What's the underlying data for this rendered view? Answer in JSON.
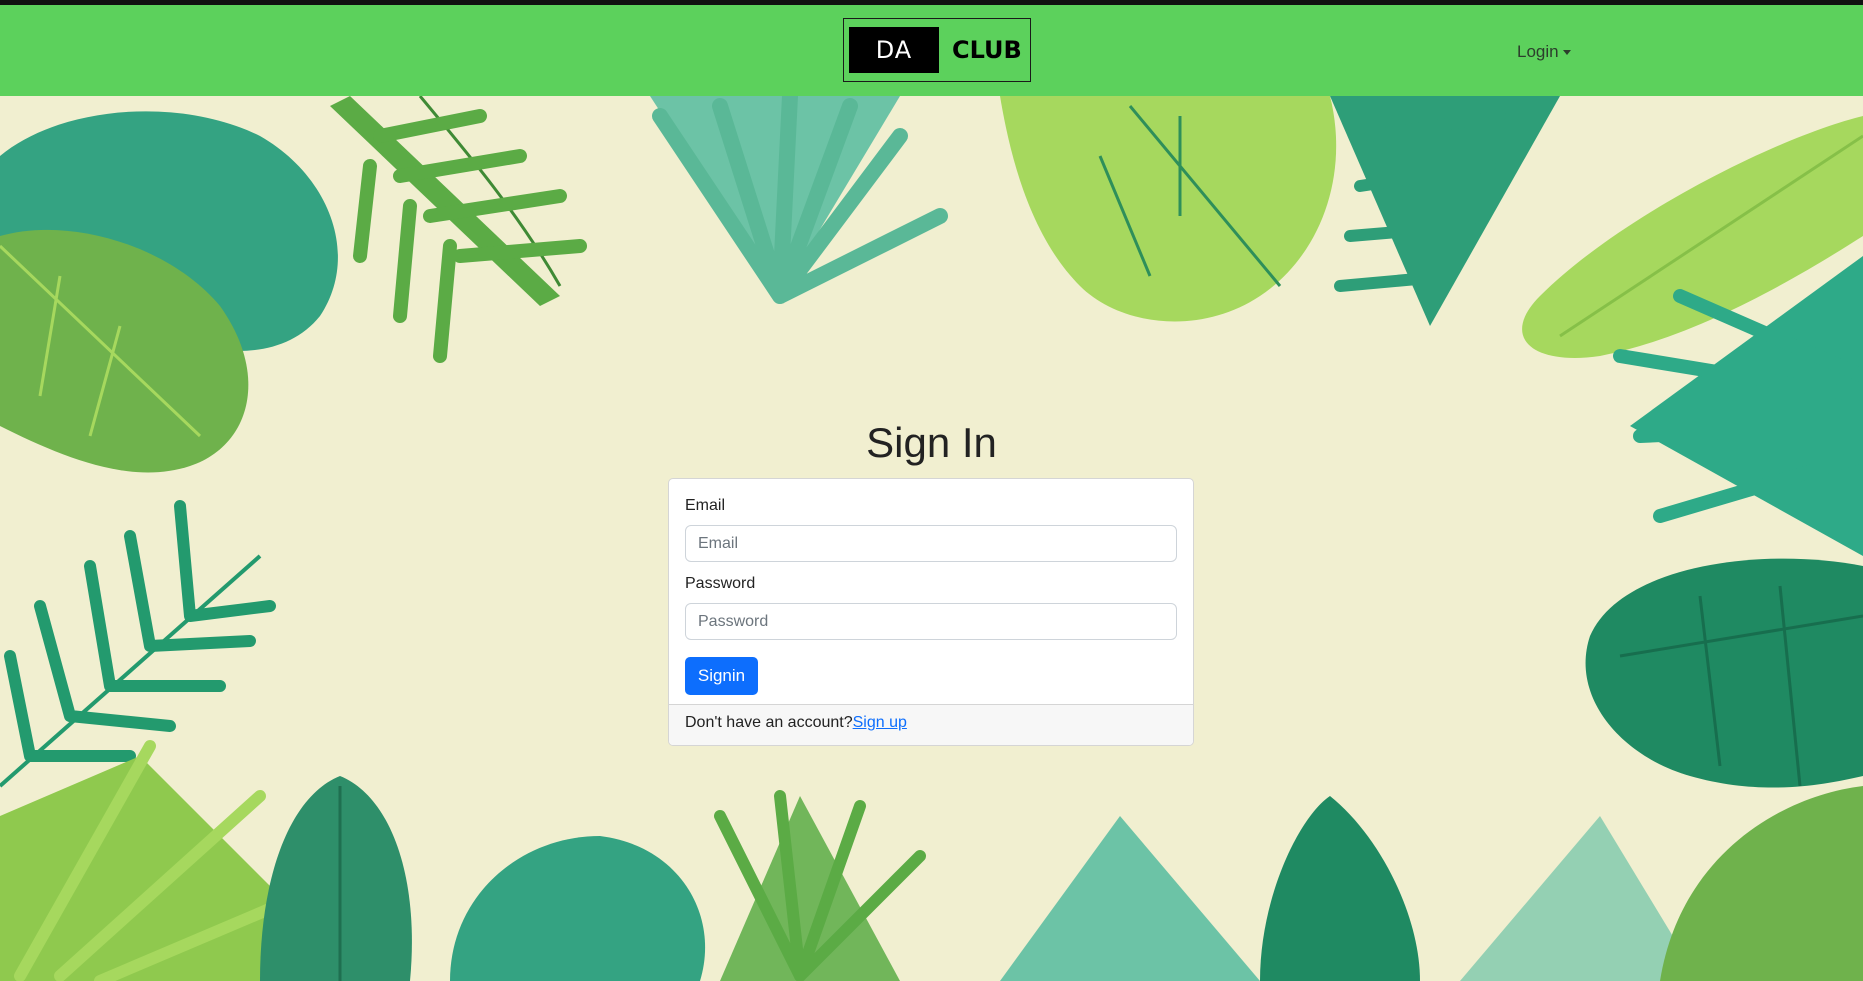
{
  "brand": {
    "logo_left": "DA",
    "logo_right": "CLUB"
  },
  "nav": {
    "login_label": "Login"
  },
  "page": {
    "title": "Sign In"
  },
  "form": {
    "email_label": "Email",
    "email_placeholder": "Email",
    "email_value": "",
    "password_label": "Password",
    "password_placeholder": "Password",
    "password_value": "",
    "submit_label": "Signin"
  },
  "footer": {
    "prompt": "Don't have an account?",
    "signup_link": "Sign up"
  },
  "colors": {
    "navbar": "#5cd15c",
    "background": "#f1efd0",
    "primary_button": "#0d6efd",
    "leaf_dark": "#2e9e78",
    "leaf_light": "#a6d85e",
    "leaf_mid": "#5bab45"
  }
}
